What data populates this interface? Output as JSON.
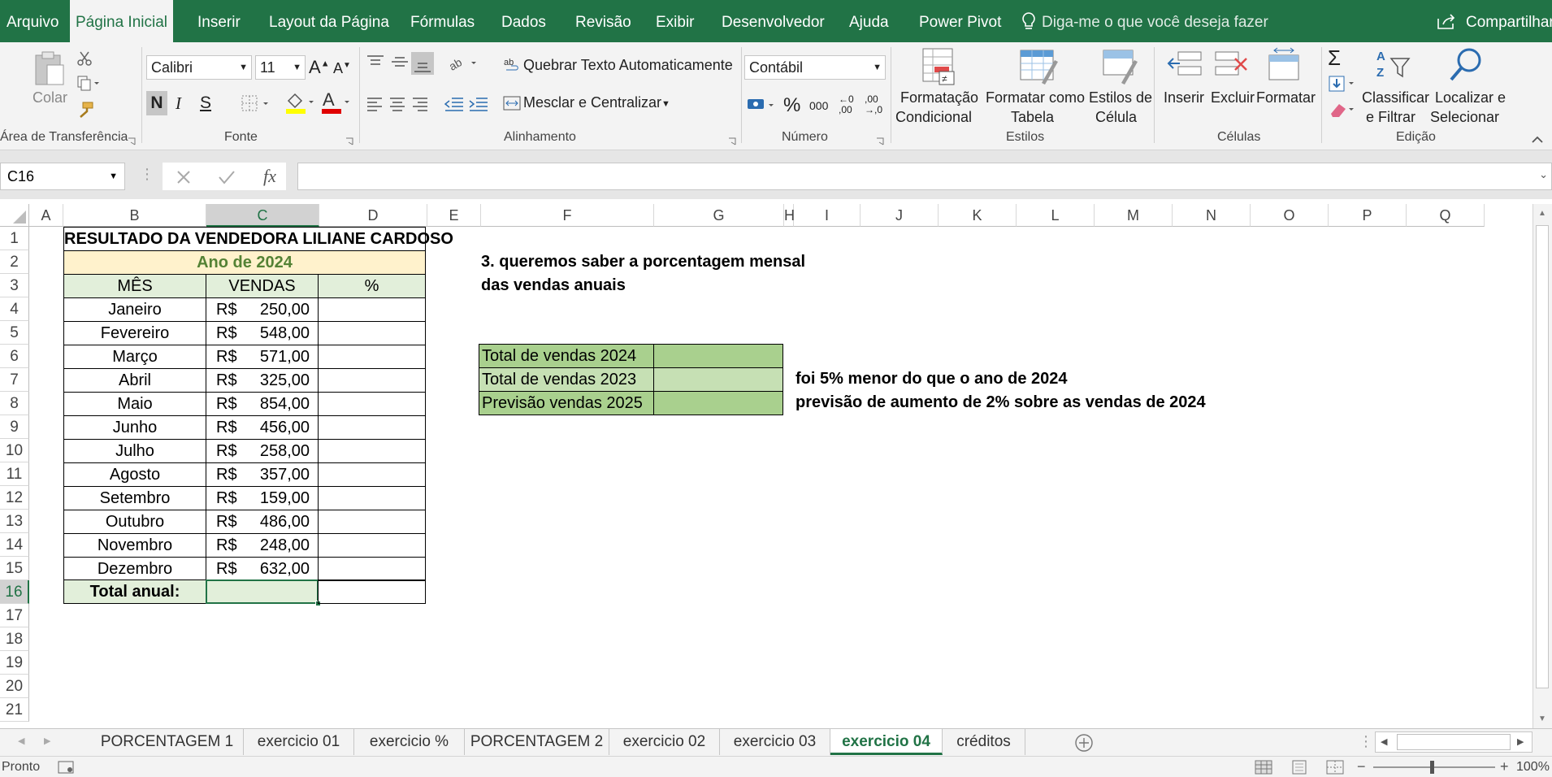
{
  "ribbon_tabs": [
    "Arquivo",
    "Página Inicial",
    "Inserir",
    "Layout da Página",
    "Fórmulas",
    "Dados",
    "Revisão",
    "Exibir",
    "Desenvolvedor",
    "Ajuda",
    "Power Pivot"
  ],
  "tellme": "Diga-me o que você deseja fazer",
  "share": "Compartilhar",
  "clipboard": {
    "paste": "Colar",
    "group": "Área de Transferência"
  },
  "font": {
    "name": "Calibri",
    "size": "11",
    "group": "Fonte",
    "bold": "N",
    "italic": "I",
    "underline": "S"
  },
  "alignment": {
    "wrap": "Quebrar Texto Automaticamente",
    "merge": "Mesclar e Centralizar",
    "group": "Alinhamento"
  },
  "number": {
    "format": "Contábil",
    "percent": "%",
    "thousands": "000",
    "inc": "←0 ,00",
    "dec": ",00 →,0",
    "group": "Número"
  },
  "styles": {
    "cond1": "Formatação",
    "cond2": "Condicional",
    "table1": "Formatar como",
    "table2": "Tabela",
    "cell1": "Estilos de",
    "cell2": "Célula",
    "group": "Estilos"
  },
  "cells": {
    "insert": "Inserir",
    "delete": "Excluir",
    "format": "Formatar",
    "group": "Células"
  },
  "editing": {
    "sort1": "Classificar",
    "sort2": "e Filtrar",
    "find1": "Localizar e",
    "find2": "Selecionar",
    "group": "Edição"
  },
  "formula_bar": {
    "name_box": "C16",
    "fx": "fx",
    "content": ""
  },
  "columns": [
    "A",
    "B",
    "C",
    "D",
    "E",
    "F",
    "G",
    "H",
    "I",
    "J",
    "K",
    "L",
    "M",
    "N",
    "O",
    "P",
    "Q"
  ],
  "rows": [
    "1",
    "2",
    "3",
    "4",
    "5",
    "6",
    "7",
    "8",
    "9",
    "10",
    "11",
    "12",
    "13",
    "14",
    "15",
    "16",
    "17",
    "18",
    "19",
    "20",
    "21"
  ],
  "table": {
    "title": "RESULTADO DA VENDEDORA LILIANE CARDOSO",
    "subtitle": "Ano de 2024",
    "headers": [
      "MÊS",
      "VENDAS",
      "%"
    ],
    "currency": "R$",
    "months": [
      "Janeiro",
      "Fevereiro",
      "Março",
      "Abril",
      "Maio",
      "Junho",
      "Julho",
      "Agosto",
      "Setembro",
      "Outubro",
      "Novembro",
      "Dezembro"
    ],
    "sales": [
      "250,00",
      "548,00",
      "571,00",
      "325,00",
      "854,00",
      "456,00",
      "258,00",
      "357,00",
      "159,00",
      "486,00",
      "248,00",
      "632,00"
    ],
    "total_label": "Total anual:"
  },
  "question": {
    "line1": "3. queremos saber a porcentagem mensal",
    "line2": "das vendas anuais"
  },
  "summary": {
    "labels": [
      "Total de vendas 2024",
      "Total de vendas 2023",
      "Previsão vendas 2025"
    ],
    "notes": [
      "foi 5% menor do que o ano de 2024",
      "previsão de aumento de 2% sobre as vendas de 2024"
    ]
  },
  "sheets": [
    "PORCENTAGEM 1",
    "exercicio 01",
    "exercicio %",
    "PORCENTAGEM 2",
    "exercicio 02",
    "exercicio 03",
    "exercicio 04",
    "créditos"
  ],
  "active_sheet": "exercicio 04",
  "status": {
    "ready": "Pronto",
    "zoom": "100%"
  },
  "colors": {
    "brand": "#217346",
    "header_green": "#e2efda",
    "subtitle_fill": "#fff2cc",
    "subtitle_text": "#548235",
    "summary_dark": "#a9d08e",
    "summary_light": "#c6e0b4"
  }
}
